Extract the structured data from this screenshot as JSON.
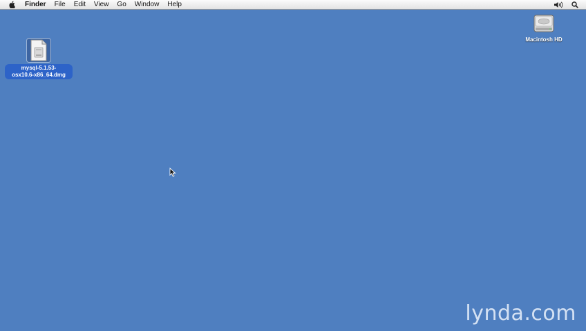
{
  "menubar": {
    "apple_icon": "apple-icon",
    "items": [
      "Finder",
      "File",
      "Edit",
      "View",
      "Go",
      "Window",
      "Help"
    ],
    "status_icons": [
      "volume-icon",
      "spotlight-search-icon"
    ]
  },
  "desktop": {
    "background_color": "#4f7fc0",
    "icons": [
      {
        "name": "mysql-5.1.53-osx10.6-x86_64.dmg",
        "label_line1": "mysql-5.1.53-",
        "label_line2": "osx10.6-x86_64.dmg",
        "selected": true,
        "icon": "disk-image-icon"
      },
      {
        "name": "Macintosh HD",
        "label": "Macintosh HD",
        "selected": false,
        "icon": "hard-drive-icon"
      }
    ]
  },
  "watermark": {
    "text": "lynda.com"
  }
}
